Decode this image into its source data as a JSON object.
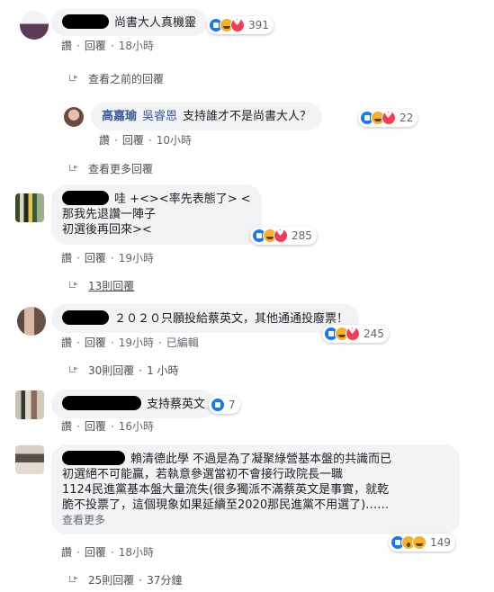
{
  "comments": [
    {
      "author_redacted": true,
      "text_lines": [
        "尚書大人真機靈"
      ],
      "reactions": [
        "like",
        "haha",
        "love"
      ],
      "reaction_count": "391",
      "actions": {
        "like": "讚",
        "reply": "回覆",
        "time": "18小時"
      }
    },
    {
      "more_replies": "查看之前的回覆"
    },
    {
      "author": "高嘉瑜",
      "tag": "吳睿恩",
      "text": "支持誰才不是尚書大人？",
      "reactions": [
        "like",
        "haha",
        "love"
      ],
      "reaction_count": "22",
      "actions": {
        "like": "讚",
        "reply": "回覆",
        "time": "10小時"
      }
    },
    {
      "more_replies": "查看更多回覆"
    },
    {
      "author_redacted": true,
      "text_lines": [
        "哇 +<><率先表態了> <",
        "那我先退讚一陣子",
        "初選後再回來><"
      ],
      "reactions": [
        "like",
        "haha",
        "love"
      ],
      "reaction_count": "285",
      "actions": {
        "like": "讚",
        "reply": "回覆",
        "time": "19小時"
      },
      "replies": "13則回覆"
    },
    {
      "author_redacted": true,
      "text_lines": [
        "２０２０只願投給蔡英文，其他通通投廢票！"
      ],
      "reactions": [
        "like",
        "haha",
        "love"
      ],
      "reaction_count": "245",
      "actions": {
        "like": "讚",
        "reply": "回覆",
        "time": "19小時",
        "edited": "已編輯"
      },
      "replies": "30則回覆",
      "replies_time": "1 小時"
    },
    {
      "author_redacted": true,
      "text_lines": [
        "支持蔡英文"
      ],
      "reactions": [
        "like"
      ],
      "reaction_count": "7",
      "actions": {
        "like": "讚",
        "reply": "回覆",
        "time": "16小時"
      }
    },
    {
      "author_redacted": true,
      "text_lines": [
        "賴清德此學 不過是為了凝聚綠營基本盤的共識而已",
        "初選絕不可能贏，若執意參選當初不會接行政院長一職",
        "1124民進黨基本盤大量流失(很多獨派不滿蔡英文是事實，就乾",
        "脆不投票了，這個現象如果延續至2020那民進黨不用選了)……"
      ],
      "see_more": "查看更多",
      "reactions": [
        "like",
        "wow",
        "haha"
      ],
      "reaction_count": "149",
      "actions": {
        "like": "讚",
        "reply": "回覆",
        "time": "18小時"
      },
      "replies": "25則回覆",
      "replies_time": "37分鐘"
    }
  ],
  "colors": {
    "link": "#385898",
    "bubble": "#f2f3f5",
    "like": "#1877f2",
    "love": "#f33e58",
    "haha": "#f7b125"
  }
}
